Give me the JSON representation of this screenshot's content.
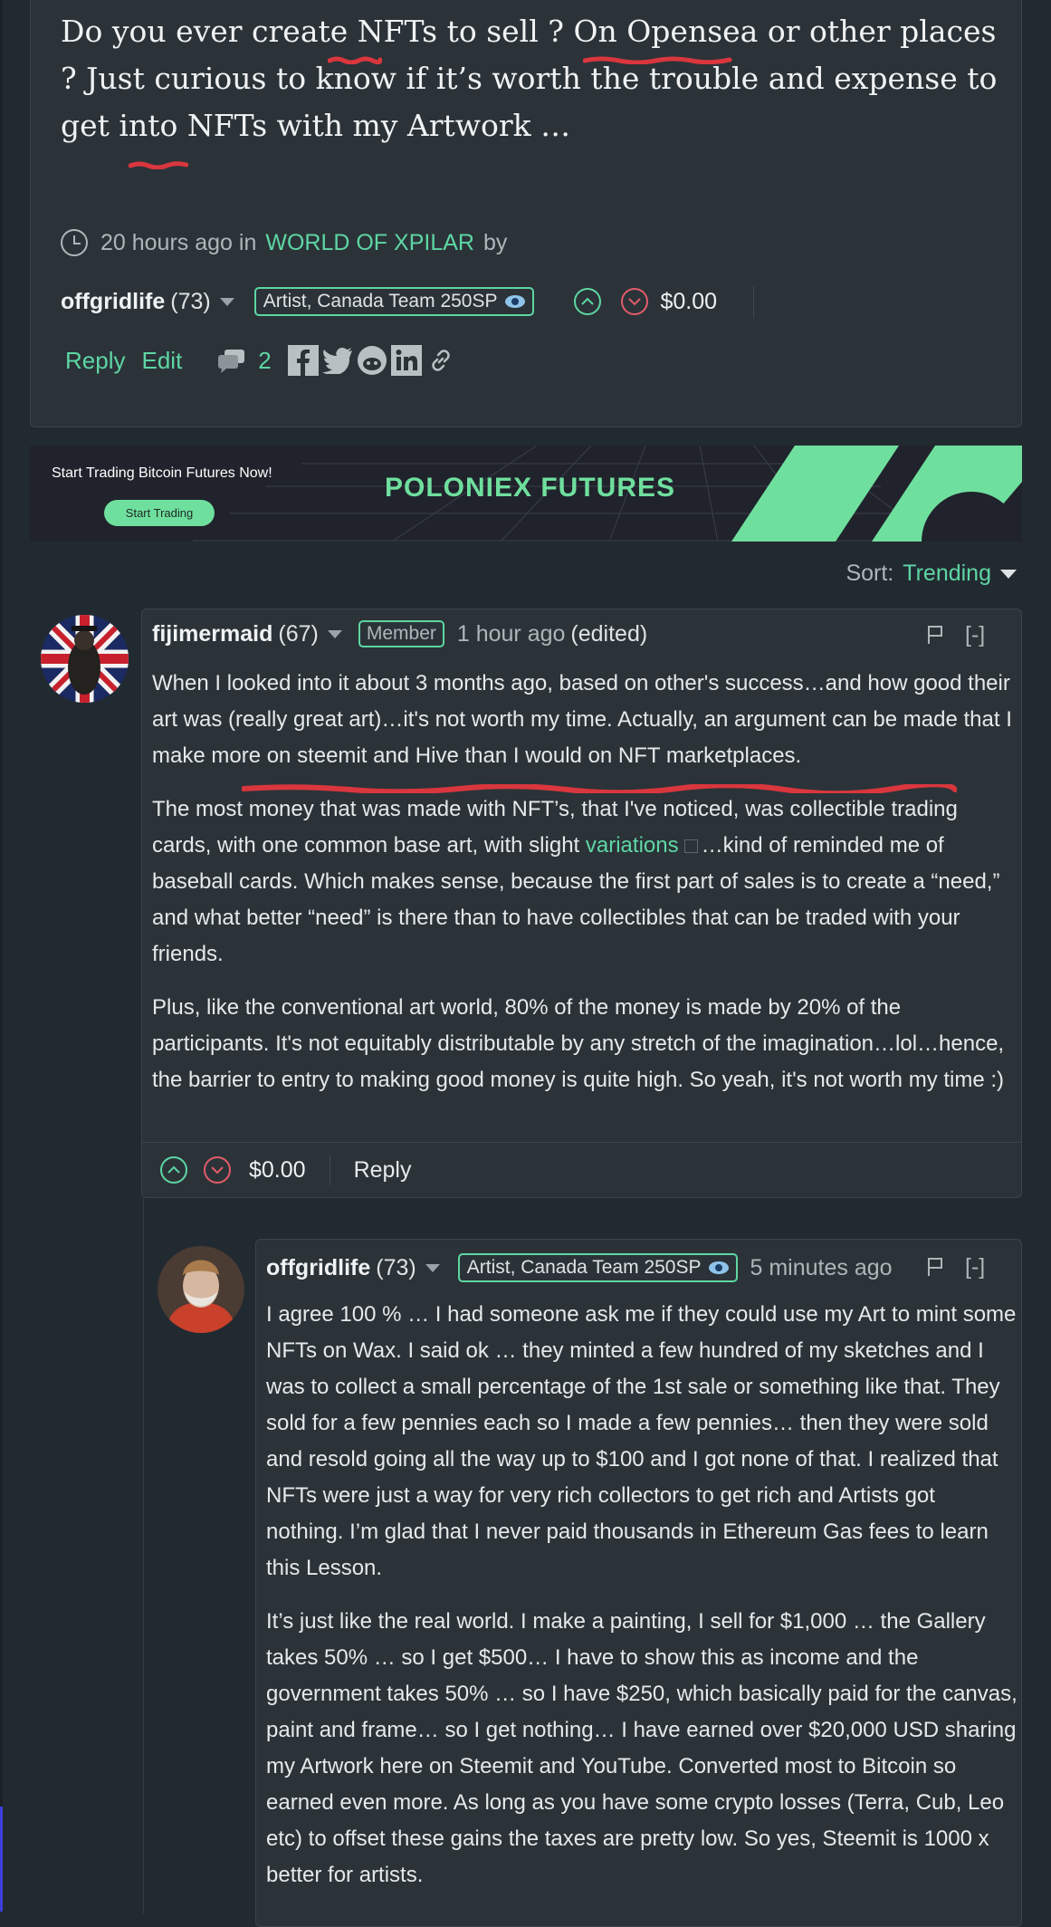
{
  "post": {
    "body": "Do you ever create NFTs to sell ? On Opensea or other places ? Just curious to know if it’s worth the trouble and expense to get into NFTs with my Artwork …",
    "time": "20 hours ago in",
    "community": "WORLD OF XPILAR",
    "by": "by",
    "author": "offgridlife",
    "reputation": "(73)",
    "badge": "Artist, Canada Team 250SP",
    "payout": "$0.00",
    "reply_label": "Reply",
    "edit_label": "Edit",
    "comment_count": "2"
  },
  "ad": {
    "tagline": "Start Trading Bitcoin Futures Now!",
    "button": "Start Trading",
    "logo": "POLONIEX  FUTURES"
  },
  "sort": {
    "label": "Sort:",
    "value": "Trending"
  },
  "comments": [
    {
      "author": "fijimermaid",
      "reputation": "(67)",
      "badge": "Member",
      "time": "1 hour ago",
      "edited": "(edited)",
      "collapse": "[-]",
      "p1": "When I looked into it about 3 months ago, based on other's success…and how good their art was (really great art)…it's not worth my time. Actually, an argument can be made that I make more on steemit and Hive than I would on NFT marketplaces.",
      "p2_before": "The most money that was made with NFT’s, that I've noticed, was collectible trading cards, with one common base art, with slight ",
      "p2_link": "variations",
      "p2_after": "…kind of reminded me of baseball cards. Which makes sense, because the first part of sales is to create a “need,” and what better “need” is there than to have collectibles that can be traded with your friends.",
      "p3": "Plus, like the conventional art world, 80% of the money is made by 20% of the participants. It's not equitably distributable by any stretch of the imagination…lol…hence, the barrier to entry to making good money is quite high. So yeah, it's not worth my time :)",
      "payout": "$0.00",
      "reply_label": "Reply"
    },
    {
      "author": "offgridlife",
      "reputation": "(73)",
      "badge": "Artist, Canada Team 250SP",
      "time": "5 minutes ago",
      "collapse": "[-]",
      "p1": "I agree 100 % … I had someone ask me if they could use my Art to mint some NFTs on Wax. I said ok … they minted a few hundred of my sketches and I was to collect a small percentage of the 1st sale or something like that. They sold for a few pennies each so I made a few pennies… then they were sold and resold going all the way up to $100 and I got none of that. I realized that NFTs were just a way for very rich collectors to get rich and Artists got nothing. I’m glad that I never paid thousands in Ethereum Gas fees to learn this Lesson.",
      "p2": "It’s just like the real world. I make a painting, I sell for $1,000 … the Gallery takes 50% … so I get $500… I have to show this as income and the government takes 50% … so I have $250, which basically paid for the canvas, paint and frame… so I get nothing… I have earned over $20,000 USD sharing my Artwork here on Steemit and YouTube. Converted most to Bitcoin so earned even more. As long as you have some crypto losses (Terra, Cub, Leo etc) to offset these gains the taxes are pretty low. So yes, Steemit is 1000 x better for artists."
    }
  ]
}
